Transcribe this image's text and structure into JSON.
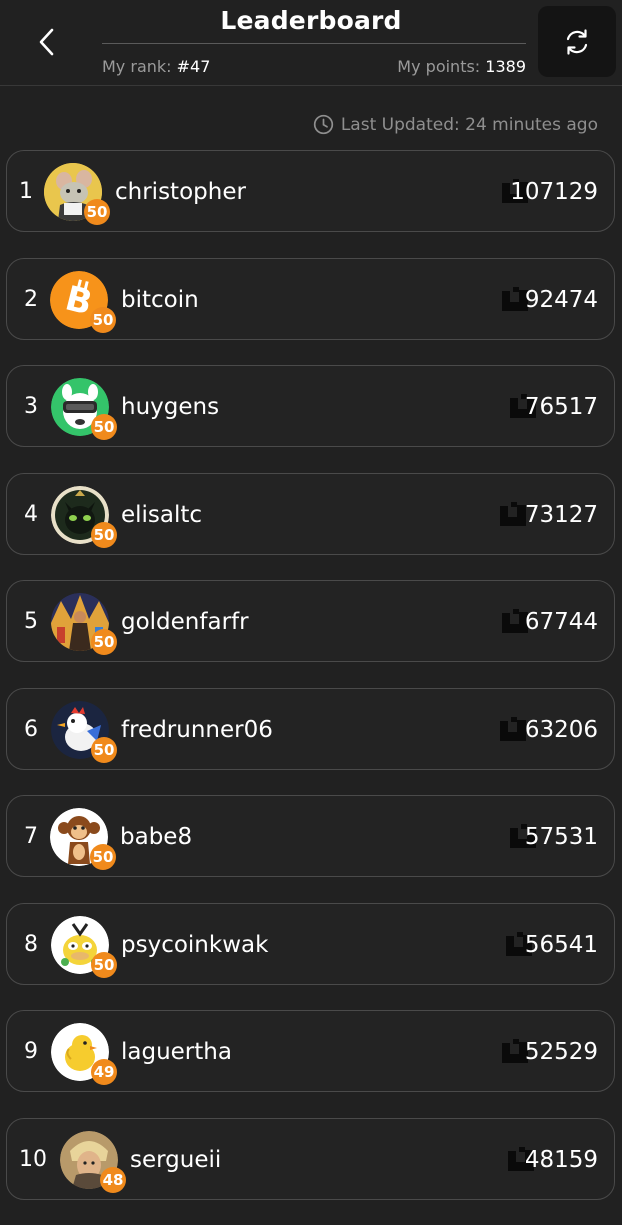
{
  "header": {
    "title": "Leaderboard",
    "my_rank_label": "My rank: ",
    "my_rank_value": "#47",
    "my_points_label": "My points: ",
    "my_points_value": "1389"
  },
  "last_updated": "Last Updated: 24 minutes ago",
  "icons": {
    "back": "chevron-left-icon",
    "refresh": "refresh-icon",
    "clock": "clock-icon",
    "points": "points-logo-icon"
  },
  "colors": {
    "background": "#212121",
    "card_border": "#4a4a4a",
    "level_badge": "#f08a1c",
    "refresh_button_bg": "#141414"
  },
  "leaderboard": [
    {
      "rank": "1",
      "name": "christopher",
      "level": "50",
      "points": "107129",
      "avatar": "rat-avatar"
    },
    {
      "rank": "2",
      "name": "bitcoin",
      "level": "50",
      "points": "92474",
      "avatar": "bitcoin-avatar"
    },
    {
      "rank": "3",
      "name": "huygens",
      "level": "50",
      "points": "76517",
      "avatar": "vr-dog-avatar"
    },
    {
      "rank": "4",
      "name": "elisaltc",
      "level": "50",
      "points": "73127",
      "avatar": "cat-avatar"
    },
    {
      "rank": "5",
      "name": "goldenfarfr",
      "level": "50",
      "points": "67744",
      "avatar": "warrior-avatar"
    },
    {
      "rank": "6",
      "name": "fredrunner06",
      "level": "50",
      "points": "63206",
      "avatar": "rooster-avatar"
    },
    {
      "rank": "7",
      "name": "babe8",
      "level": "50",
      "points": "57531",
      "avatar": "monkey-avatar"
    },
    {
      "rank": "8",
      "name": "psycoinkwak",
      "level": "50",
      "points": "56541",
      "avatar": "duck-avatar"
    },
    {
      "rank": "9",
      "name": "laguertha",
      "level": "49",
      "points": "52529",
      "avatar": "chick-avatar"
    },
    {
      "rank": "10",
      "name": "sergueii",
      "level": "48",
      "points": "48159",
      "avatar": "portrait-avatar"
    }
  ]
}
